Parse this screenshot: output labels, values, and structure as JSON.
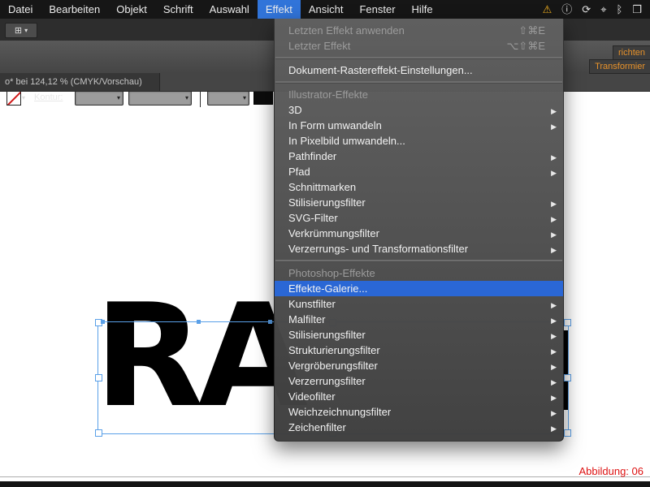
{
  "menubar": {
    "items": [
      {
        "label": "Datei",
        "name": "menubar-item-datei"
      },
      {
        "label": "Bearbeiten",
        "name": "menubar-item-bearbeiten"
      },
      {
        "label": "Objekt",
        "name": "menubar-item-objekt"
      },
      {
        "label": "Schrift",
        "name": "menubar-item-schrift"
      },
      {
        "label": "Auswahl",
        "name": "menubar-item-auswahl"
      },
      {
        "label": "Effekt",
        "name": "menubar-item-effekt",
        "active": true
      },
      {
        "label": "Ansicht",
        "name": "menubar-item-ansicht"
      },
      {
        "label": "Fenster",
        "name": "menubar-item-fenster"
      },
      {
        "label": "Hilfe",
        "name": "menubar-item-hilfe"
      }
    ],
    "status_icons": [
      {
        "glyph": "⚠",
        "name": "warning-icon",
        "color": "#f2b01e"
      },
      {
        "glyph": "ⓘ",
        "name": "info-icon"
      },
      {
        "glyph": "⟳",
        "name": "sync-icon"
      },
      {
        "glyph": "⌖",
        "name": "target-icon"
      },
      {
        "glyph": "ᛒ",
        "name": "bluetooth-icon"
      },
      {
        "glyph": "❒",
        "name": "display-icon"
      }
    ]
  },
  "appbar": {
    "layout_icon": "⊞",
    "layout_caret": "▾"
  },
  "toolbar": {
    "kontur_label": "Kontur:",
    "swatch_caret": "▾",
    "combo_caret": "▾",
    "align_tab": "richten",
    "transform_tab": "Transformier"
  },
  "document_tab": {
    "title": "o* bei 124,12 % (CMYK/Vorschau)"
  },
  "effekt_menu": {
    "items": [
      {
        "label": "Letzten Effekt anwenden",
        "shortcut": "⇧⌘E",
        "disabled": true
      },
      {
        "label": "Letzter Effekt",
        "shortcut": "⌥⇧⌘E",
        "disabled": true
      },
      {
        "separator": true
      },
      {
        "label": "Dokument-Rastereffekt-Einstellungen..."
      },
      {
        "separator": true
      },
      {
        "label": "Illustrator-Effekte",
        "header": true
      },
      {
        "label": "3D",
        "submenu": true
      },
      {
        "label": "In Form umwandeln",
        "submenu": true
      },
      {
        "label": "In Pixelbild umwandeln..."
      },
      {
        "label": "Pathfinder",
        "submenu": true
      },
      {
        "label": "Pfad",
        "submenu": true
      },
      {
        "label": "Schnittmarken"
      },
      {
        "label": "Stilisierungsfilter",
        "submenu": true
      },
      {
        "label": "SVG-Filter",
        "submenu": true
      },
      {
        "label": "Verkrümmungsfilter",
        "submenu": true
      },
      {
        "label": "Verzerrungs- und Transformationsfilter",
        "submenu": true
      },
      {
        "separator": true
      },
      {
        "label": "Photoshop-Effekte",
        "header": true
      },
      {
        "label": "Effekte-Galerie...",
        "highlighted": true
      },
      {
        "label": "Kunstfilter",
        "submenu": true
      },
      {
        "label": "Malfilter",
        "submenu": true
      },
      {
        "label": "Stilisierungsfilter",
        "submenu": true
      },
      {
        "label": "Strukturierungsfilter",
        "submenu": true
      },
      {
        "label": "Vergröberungsfilter",
        "submenu": true
      },
      {
        "label": "Verzerrungsfilter",
        "submenu": true
      },
      {
        "label": "Videofilter",
        "submenu": true
      },
      {
        "label": "Weichzeichnungsfilter",
        "submenu": true
      },
      {
        "label": "Zeichenfilter",
        "submenu": true
      }
    ]
  },
  "canvas": {
    "selected_text": "RA"
  },
  "figure_label": "Abbildung: 06",
  "colors": {
    "menu_highlight": "#2a67d5",
    "menubar_active": "#3174d9",
    "selection_blue": "#5aa0e8",
    "panel_tab_orange": "#e8922a",
    "figure_red": "#dd1111",
    "warning_yellow": "#f2b01e"
  }
}
